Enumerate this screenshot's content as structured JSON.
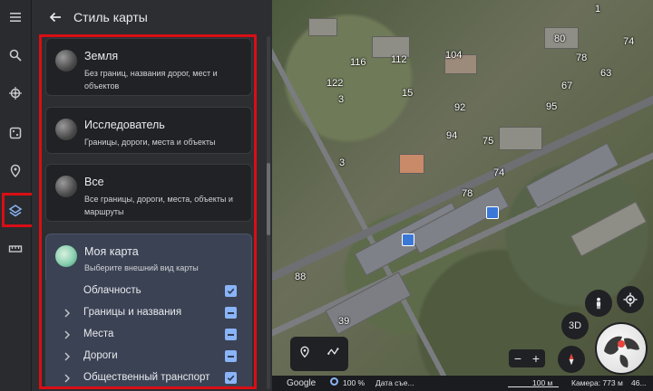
{
  "panel": {
    "title": "Стиль карты",
    "cards": [
      {
        "title": "Земля",
        "desc": "Без границ, названия дорог, мест и объектов"
      },
      {
        "title": "Исследователь",
        "desc": "Границы, дороги, места и объекты"
      },
      {
        "title": "Все",
        "desc": "Все границы, дороги, места, объекты и маршруты"
      },
      {
        "title": "Моя карта",
        "desc": "Выберите внешний вид карты"
      }
    ],
    "options": [
      {
        "label": "Облачность",
        "state": "checked"
      },
      {
        "label": "Границы и названия",
        "state": "partial"
      },
      {
        "label": "Места",
        "state": "partial"
      },
      {
        "label": "Дороги",
        "state": "partial"
      },
      {
        "label": "Общественный транспорт",
        "state": "checked"
      }
    ]
  },
  "map": {
    "labels": [
      "1",
      "80",
      "74",
      "116",
      "112",
      "104",
      "78",
      "122",
      "15",
      "63",
      "67",
      "3",
      "92",
      "95",
      "94",
      "75",
      "3",
      "74",
      "78",
      "88",
      "39"
    ],
    "view_3d_label": "3D",
    "zoom_minus": "−",
    "zoom_plus": "+"
  },
  "status_bar": {
    "brand": "Google",
    "progress": "100 %",
    "data_label": "Дата съе...",
    "scale": "100 м",
    "camera": "Камера: 773 м",
    "coords": "46..."
  },
  "colors": {
    "highlight": "#d90e15",
    "checkbox": "#8ab4f8",
    "selected_card": "#3b4254"
  }
}
